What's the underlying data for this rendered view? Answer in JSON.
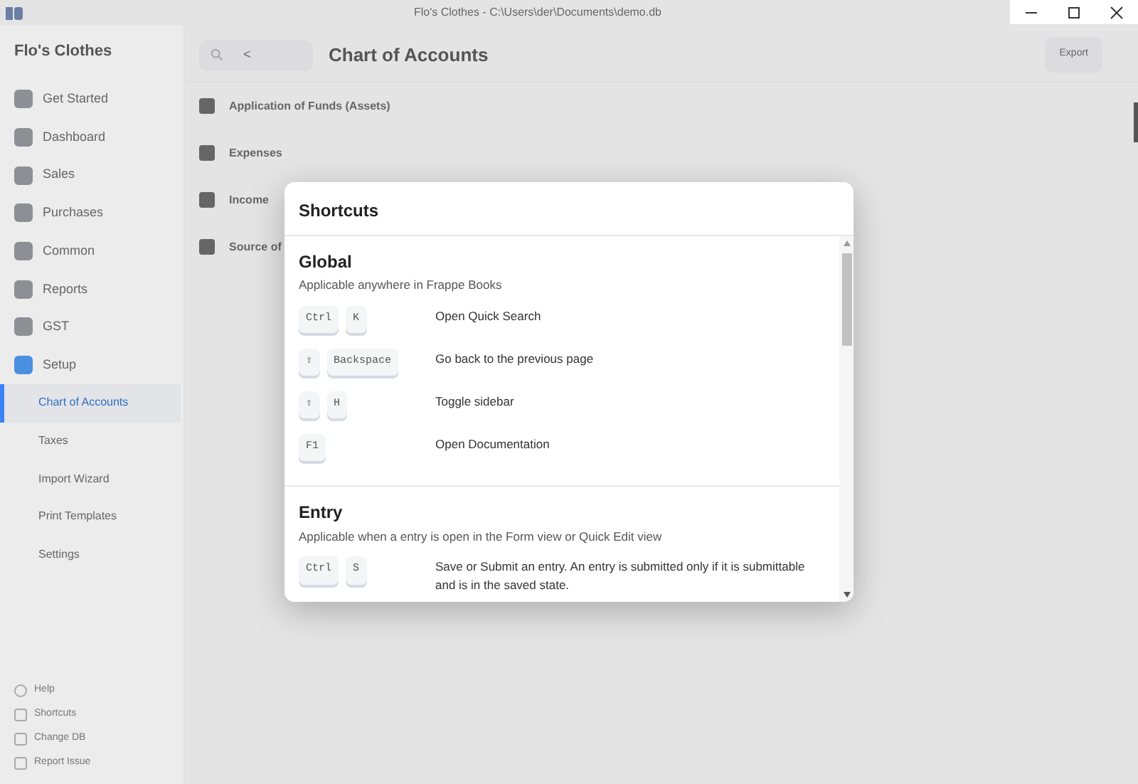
{
  "window": {
    "title": "Flo's Clothes - C:\\Users\\der\\Documents\\demo.db"
  },
  "sidebar": {
    "company": "Flo's Clothes",
    "items": [
      {
        "label": "Get Started",
        "selected": false
      },
      {
        "label": "Dashboard",
        "selected": false
      },
      {
        "label": "Sales",
        "selected": false
      },
      {
        "label": "Purchases",
        "selected": false
      },
      {
        "label": "Common",
        "selected": false
      },
      {
        "label": "Reports",
        "selected": false
      },
      {
        "label": "GST",
        "selected": false
      },
      {
        "label": "Setup",
        "selected": false,
        "children": [
          {
            "label": "Chart of Accounts",
            "selected": true
          },
          {
            "label": "Taxes",
            "selected": false
          },
          {
            "label": "Import Wizard",
            "selected": false
          },
          {
            "label": "Print Templates",
            "selected": false
          },
          {
            "label": "Settings",
            "selected": false
          }
        ]
      }
    ],
    "footer": [
      "Help",
      "Shortcuts",
      "Change DB",
      "Report Issue"
    ]
  },
  "header": {
    "back": "<",
    "title": "Chart of Accounts",
    "button": "Export"
  },
  "accounts": [
    "Application of Funds (Assets)",
    "Expenses",
    "Income",
    "Source of"
  ],
  "dialog": {
    "title": "Shortcuts",
    "sections": [
      {
        "title": "Global",
        "description": "Applicable anywhere in Frappe Books",
        "shortcuts": [
          {
            "keys": [
              "Ctrl",
              "K"
            ],
            "description": "Open Quick Search"
          },
          {
            "keys": [
              "⇧",
              "Backspace"
            ],
            "description": "Go back to the previous page"
          },
          {
            "keys": [
              "⇧",
              "H"
            ],
            "description": "Toggle sidebar"
          },
          {
            "keys": [
              "F1"
            ],
            "description": "Open Documentation"
          }
        ]
      },
      {
        "title": "Entry",
        "description": "Applicable when a entry is open in the Form view or Quick Edit view",
        "shortcuts": [
          {
            "keys": [
              "Ctrl",
              "S"
            ],
            "description": "Save or Submit an entry. An entry is submitted only if it is submittable and is in the saved state."
          }
        ]
      }
    ]
  }
}
